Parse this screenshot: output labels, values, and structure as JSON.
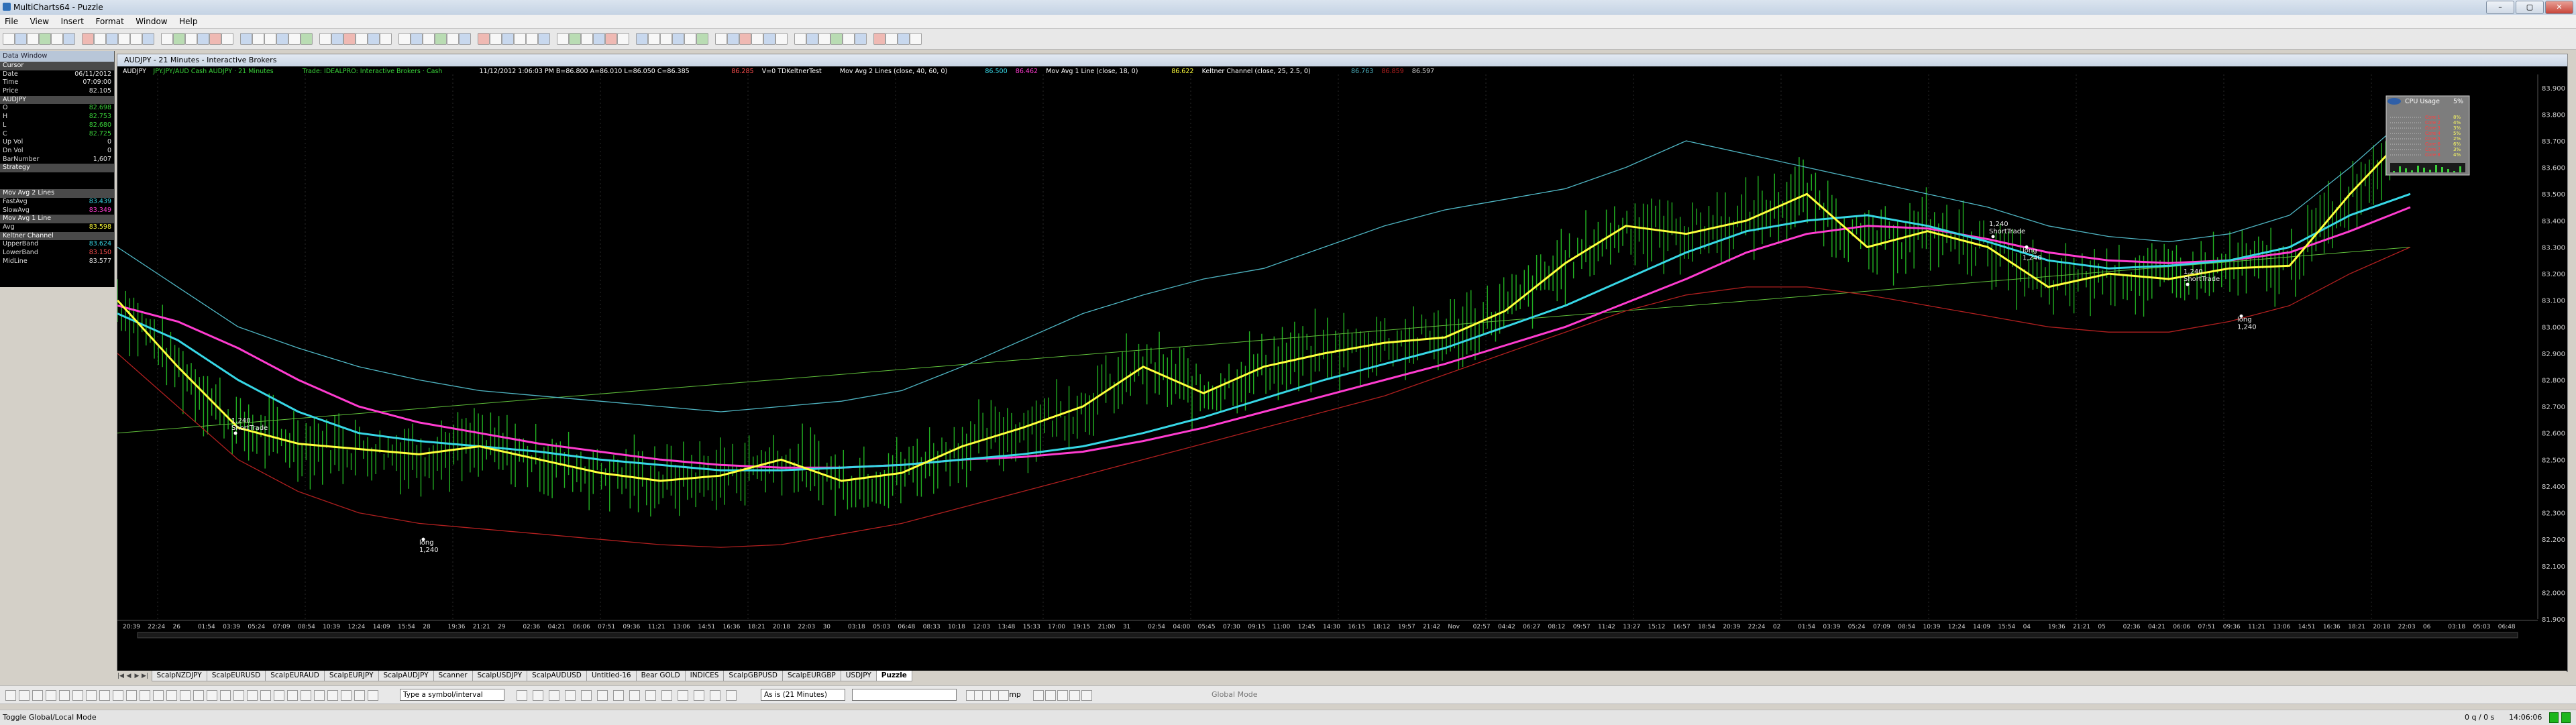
{
  "window": {
    "title": "MultiCharts64 - Puzzle",
    "controls": [
      "–",
      "▢",
      "✕"
    ]
  },
  "menu": [
    "File",
    "View",
    "Insert",
    "Format",
    "Window",
    "Help"
  ],
  "data_window": {
    "title": "Data Window",
    "rows": [
      {
        "label": "Cursor",
        "value": "",
        "hdr": true
      },
      {
        "label": "Date",
        "value": "06/11/2012"
      },
      {
        "label": "Time",
        "value": "07:09:00"
      },
      {
        "label": "Price",
        "value": "82.105"
      },
      {
        "label": "AUDJPY",
        "value": "",
        "hdr": true
      },
      {
        "label": "O",
        "value": "82.698",
        "color": "green"
      },
      {
        "label": "H",
        "value": "82.753",
        "color": "green"
      },
      {
        "label": "L",
        "value": "82.680",
        "color": "green"
      },
      {
        "label": "C",
        "value": "82.725",
        "color": "green"
      },
      {
        "label": "Up Vol",
        "value": "0"
      },
      {
        "label": "Dn Vol",
        "value": "0"
      },
      {
        "label": "BarNumber",
        "value": "1,607"
      },
      {
        "label": "Strategy",
        "value": "",
        "hdr": true
      },
      {
        "label": "",
        "value": ""
      },
      {
        "label": "",
        "value": ""
      },
      {
        "label": "Mov Avg 2 Lines",
        "value": "",
        "hdr": true
      },
      {
        "label": "FastAvg",
        "value": "83.439",
        "color": "cyan"
      },
      {
        "label": "SlowAvg",
        "value": "83.349",
        "color": "magenta"
      },
      {
        "label": "Mov Avg 1 Line",
        "value": "",
        "hdr": true
      },
      {
        "label": "Avg",
        "value": "83.598",
        "color": "yellow"
      },
      {
        "label": "Keltner Channel",
        "value": "",
        "hdr": true
      },
      {
        "label": "UpperBand",
        "value": "83.624",
        "color": "cyan"
      },
      {
        "label": "LowerBand",
        "value": "83.150",
        "color": "red"
      },
      {
        "label": "MidLine",
        "value": "83.577"
      }
    ]
  },
  "chart_window": {
    "title": "AUDJPY - 21 Minutes - Interactive Brokers",
    "status_line": {
      "symbol": "AUDJPY",
      "instrument": "JPY.JPY/AUD Cash AUDJPY · 21 Minutes",
      "trade": "Trade: IDEALPRO: Interactive Brokers · Cash",
      "ohlc": "11/12/2012  1:06:03 PM  B=86.800  A=86.010  L=86.050  C=86.385",
      "change": "86.285",
      "signal": "V=0  TDKeltnerTest",
      "mov2": "Mov Avg 2 Lines  (close, 40, 60, 0)",
      "mov2_fast": "86.500",
      "mov2_slow": "86.462",
      "mov1": "Mov Avg 1 Line  (close, 18, 0)",
      "mov1_val": "86.622",
      "kc": "Keltner Channel  (close, 25, 2.5, 0)",
      "kc_upper": "86.763",
      "kc_lower": "86.859",
      "kc_mid": "86.597"
    },
    "colors": {
      "bars": "#22b022",
      "fast_avg": "#37d7e6",
      "slow_avg": "#ff3cd0",
      "avg": "#ffff3c",
      "upper_band": "#4fb6c4",
      "lower_band": "#b01f1f",
      "trendline": "#5fbf3a"
    },
    "markers": [
      {
        "label": "1,240",
        "sub": "ShortTrade",
        "kind": "short"
      },
      {
        "label": "long",
        "sub": "1,240",
        "kind": "long"
      },
      {
        "label": "1,240",
        "sub": "ShortTrade",
        "kind": "short"
      },
      {
        "label": "long",
        "sub": "1,240",
        "kind": "long"
      },
      {
        "label": "1,240",
        "sub": "ShortTrade",
        "kind": "short"
      },
      {
        "label": "long",
        "sub": "1,240",
        "kind": "long"
      }
    ],
    "cpu_widget": {
      "title": "CPU Usage",
      "total": "5%",
      "cores": [
        {
          "label": "Core 1",
          "value": "8%"
        },
        {
          "label": "Core 2",
          "value": "4%"
        },
        {
          "label": "Core 3",
          "value": "3%"
        },
        {
          "label": "Core 4",
          "value": "5%"
        },
        {
          "label": "Core 5",
          "value": "2%"
        },
        {
          "label": "Core 6",
          "value": "6%"
        },
        {
          "label": "Core 7",
          "value": "3%"
        },
        {
          "label": "Core 8",
          "value": "4%"
        }
      ]
    }
  },
  "chart_data": {
    "type": "candlestick-line",
    "title": "AUDJPY - 21 Minutes - Interactive Brokers",
    "y_ticks": [
      "83.900",
      "83.800",
      "83.700",
      "83.600",
      "83.500",
      "83.400",
      "83.300",
      "83.200",
      "83.100",
      "83.000",
      "82.900",
      "82.800",
      "82.700",
      "82.600",
      "82.500",
      "82.400",
      "82.300",
      "82.200",
      "82.100",
      "82.000",
      "81.900"
    ],
    "ylim": [
      81.9,
      83.95
    ],
    "x_ticks": [
      "20:39",
      "22:24",
      "26",
      "01:54",
      "03:39",
      "05:24",
      "07:09",
      "08:54",
      "10:39",
      "12:24",
      "14:09",
      "15:54",
      "28",
      "19:36",
      "21:21",
      "29",
      "02:36",
      "04:21",
      "06:06",
      "07:51",
      "09:36",
      "11:21",
      "13:06",
      "14:51",
      "16:36",
      "18:21",
      "20:18",
      "22:03",
      "30",
      "03:18",
      "05:03",
      "06:48",
      "08:33",
      "10:18",
      "12:03",
      "13:48",
      "15:33",
      "17:00",
      "19:15",
      "21:00",
      "31",
      "02:54",
      "04:00",
      "05:45",
      "07:30",
      "09:15",
      "11:00",
      "12:45",
      "14:30",
      "16:15",
      "18:12",
      "19:57",
      "21:42",
      "Nov",
      "02:57",
      "04:42",
      "06:27",
      "08:12",
      "09:57",
      "11:42",
      "13:27",
      "15:12",
      "16:57",
      "18:54",
      "20:39",
      "22:24",
      "02",
      "01:54",
      "03:39",
      "05:24",
      "07:09",
      "08:54",
      "10:39",
      "12:24",
      "14:09",
      "15:54",
      "04",
      "19:36",
      "21:21",
      "05",
      "02:36",
      "04:21",
      "06:06",
      "07:51",
      "09:36",
      "11:21",
      "13:06",
      "14:51",
      "16:36",
      "18:21",
      "20:18",
      "22:03",
      "06",
      "03:18",
      "05:03",
      "06:48"
    ],
    "series": [
      {
        "name": "FastAvg",
        "values": [
          83.05,
          82.95,
          82.8,
          82.68,
          82.6,
          82.57,
          82.55,
          82.53,
          82.5,
          82.48,
          82.46,
          82.46,
          82.47,
          82.48,
          82.5,
          82.52,
          82.55,
          82.6,
          82.66,
          82.73,
          82.8,
          82.86,
          82.92,
          83.0,
          83.08,
          83.18,
          83.28,
          83.36,
          83.4,
          83.42,
          83.38,
          83.32,
          83.25,
          83.22,
          83.23,
          83.25,
          83.3,
          83.42,
          83.5
        ]
      },
      {
        "name": "SlowAvg",
        "values": [
          83.08,
          83.02,
          82.92,
          82.8,
          82.7,
          82.64,
          82.6,
          82.56,
          82.53,
          82.5,
          82.48,
          82.47,
          82.47,
          82.48,
          82.5,
          82.51,
          82.53,
          82.57,
          82.62,
          82.68,
          82.74,
          82.8,
          82.86,
          82.93,
          83.0,
          83.09,
          83.18,
          83.28,
          83.35,
          83.38,
          83.37,
          83.33,
          83.28,
          83.25,
          83.24,
          83.25,
          83.28,
          83.36,
          83.45
        ]
      },
      {
        "name": "Avg",
        "values": [
          83.1,
          82.85,
          82.62,
          82.56,
          82.54,
          82.52,
          82.55,
          82.5,
          82.45,
          82.42,
          82.44,
          82.5,
          82.42,
          82.45,
          82.55,
          82.62,
          82.7,
          82.85,
          82.75,
          82.85,
          82.9,
          82.94,
          82.96,
          83.06,
          83.24,
          83.38,
          83.35,
          83.4,
          83.5,
          83.3,
          83.36,
          83.3,
          83.15,
          83.2,
          83.18,
          83.22,
          83.23,
          83.5,
          83.74
        ]
      },
      {
        "name": "UpperBand",
        "values": [
          83.3,
          83.15,
          83.0,
          82.92,
          82.85,
          82.8,
          82.76,
          82.74,
          82.72,
          82.7,
          82.68,
          82.7,
          82.72,
          82.76,
          82.85,
          82.95,
          83.05,
          83.12,
          83.18,
          83.22,
          83.3,
          83.38,
          83.44,
          83.48,
          83.52,
          83.6,
          83.7,
          83.65,
          83.6,
          83.55,
          83.5,
          83.45,
          83.38,
          83.34,
          83.32,
          83.35,
          83.42,
          83.6,
          83.8
        ]
      },
      {
        "name": "LowerBand",
        "values": [
          82.9,
          82.7,
          82.5,
          82.38,
          82.3,
          82.26,
          82.24,
          82.22,
          82.2,
          82.18,
          82.17,
          82.18,
          82.22,
          82.26,
          82.32,
          82.38,
          82.44,
          82.5,
          82.56,
          82.62,
          82.68,
          82.74,
          82.82,
          82.9,
          82.98,
          83.06,
          83.12,
          83.15,
          83.15,
          83.12,
          83.08,
          83.04,
          83.0,
          82.98,
          82.98,
          83.02,
          83.08,
          83.2,
          83.3
        ]
      }
    ]
  },
  "tabs": [
    "ScalpNZDJPY",
    "ScalpEURUSD",
    "ScalpEURAUD",
    "ScalpEURJPY",
    "ScalpAUDJPY",
    "Scanner",
    "ScalpUSDJPY",
    "ScalpAUDUSD",
    "Untitled-16",
    "Bear GOLD",
    "INDICES",
    "ScalpGBPUSD",
    "ScalpEURGBP",
    "USDJPY",
    "Puzzle"
  ],
  "active_tab": "Puzzle",
  "drawbar": {
    "symbol_field": "Type a symbol/interval",
    "interval": "As is (21 Minutes)",
    "jump": "Jump",
    "global_mode": "Global Mode"
  },
  "statusbar": {
    "hint": "Toggle Global/Local Mode",
    "queue": "0 q / 0 s",
    "time": "14:06:06"
  }
}
